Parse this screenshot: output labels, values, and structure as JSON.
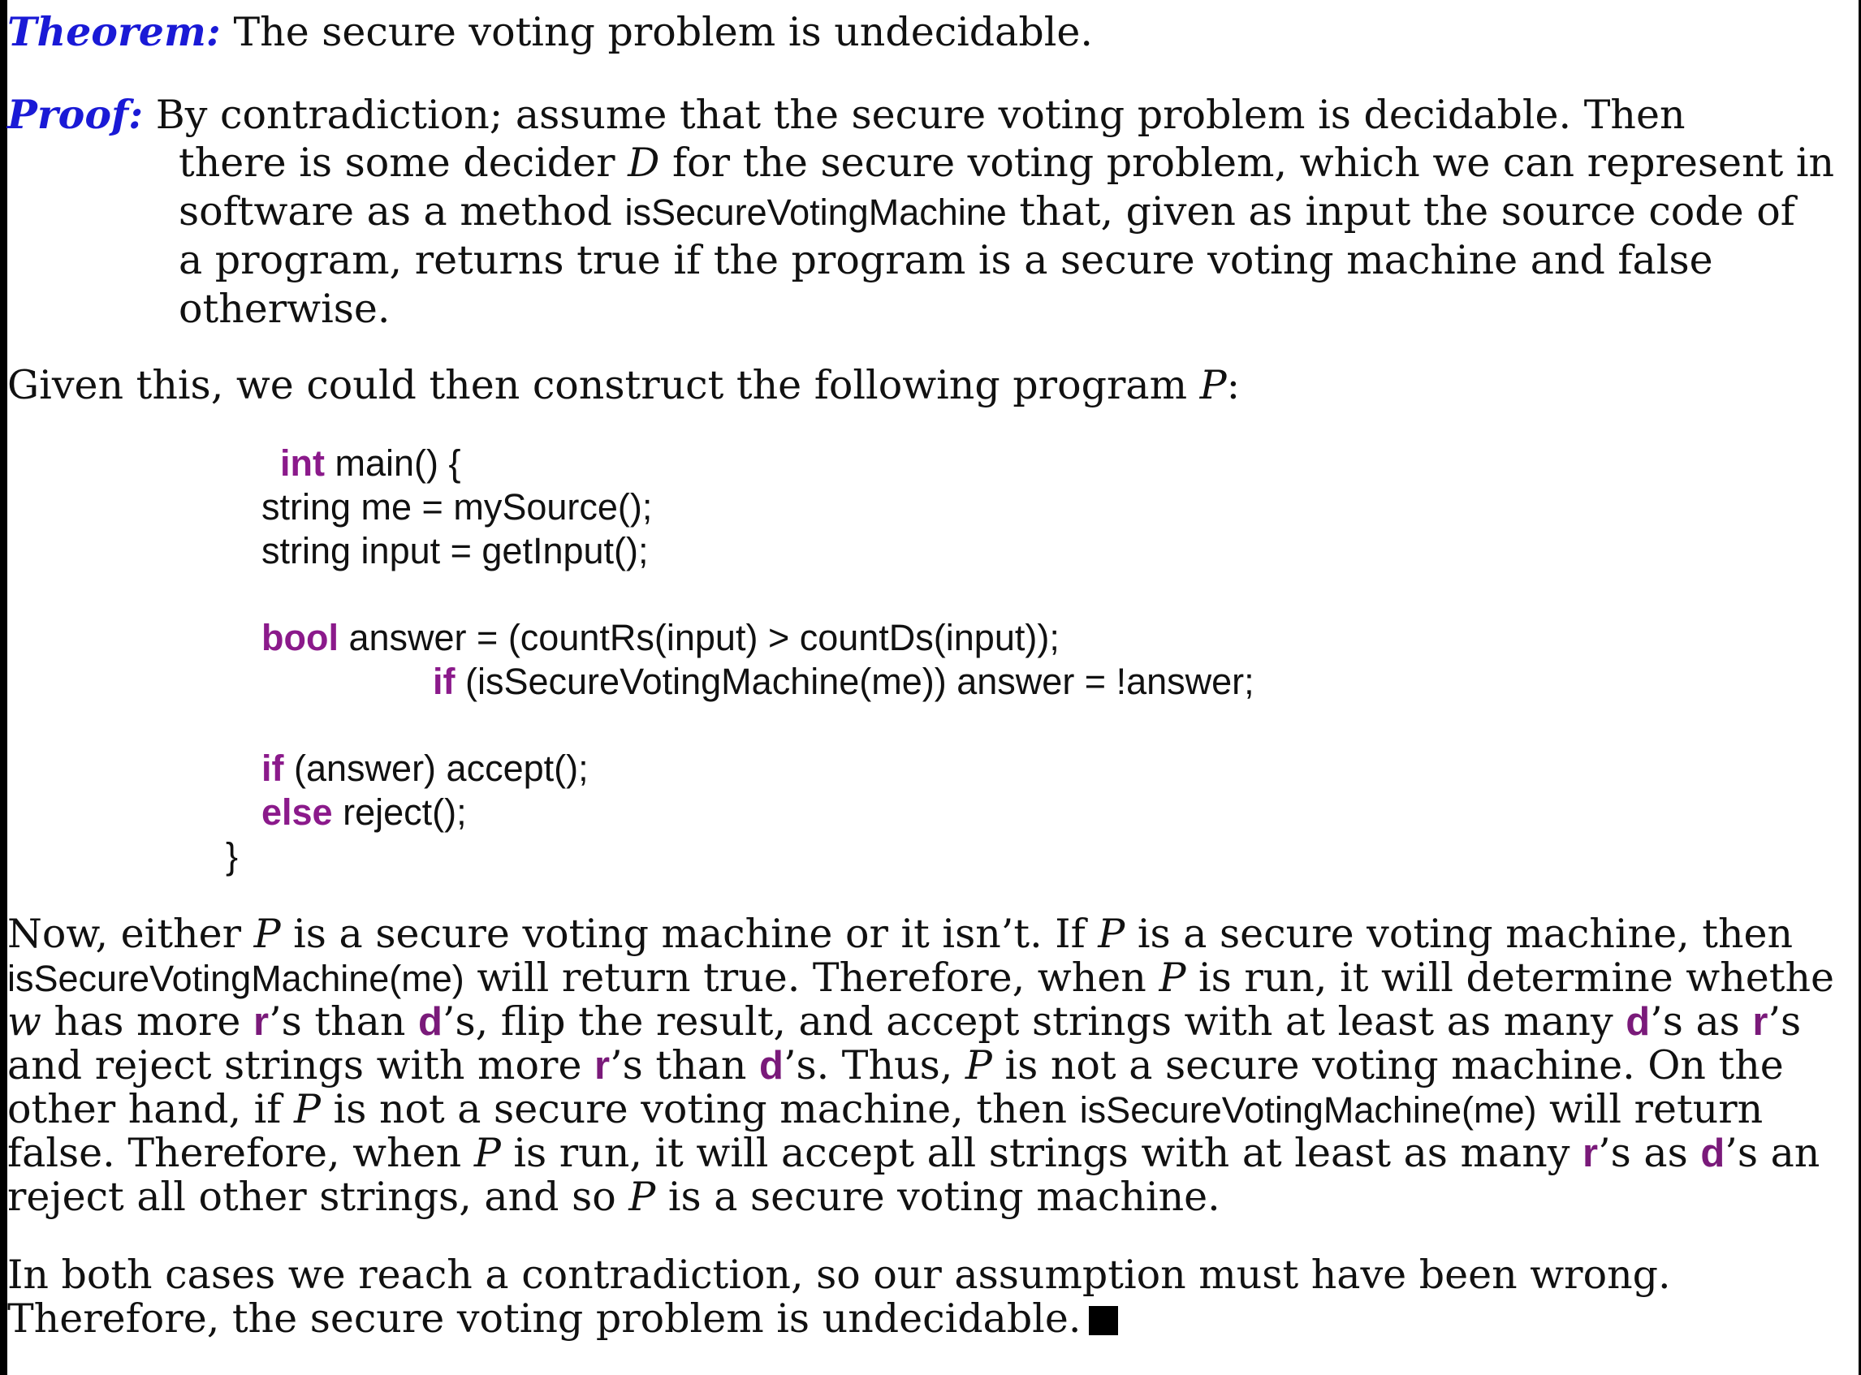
{
  "theorem": {
    "label": "Theorem:",
    "text": " The secure voting problem is undecidable."
  },
  "proof": {
    "label": "Proof:",
    "l1": " By contradiction; assume that the secure voting problem is decidable. Then",
    "l2a": "there is some decider ",
    "l2var": "D",
    "l2b": " for the secure voting problem, which we can represent in",
    "l3a": "software as a method ",
    "l3ident": "isSecureVotingMachine",
    "l3b": " that, given as input the source code of",
    "l4": "a program, returns true if the program is a secure voting machine and false",
    "l5": "otherwise."
  },
  "given": {
    "text": "Given this, we could then construct the following program ",
    "var": "P",
    "end": ":"
  },
  "code": {
    "line1_kw": "int",
    "line1_rest": " main() {",
    "line2": "string me = mySource();",
    "line3": "string input = getInput();",
    "line4_kw": "bool",
    "line4_rest": " answer = (countRs(input) > countDs(input));",
    "line5_kw": "if",
    "line5_rest": " (isSecureVotingMachine(me)) answer = !answer;",
    "line6_kw": "if",
    "line6_rest": " (answer) accept();",
    "line7_kw": "else",
    "line7_rest": " reject();",
    "line8": "}"
  },
  "argument": {
    "p1a": "Now, either ",
    "P": "P",
    "p1b": " is a secure voting machine or it isn’t. If ",
    "p1c": " is a secure voting machine, then",
    "p2ident": "isSecureVotingMachine(me)",
    "p2a": " will return true. Therefore, when ",
    "p2b": " is run, it will determine whethe",
    "w": "w",
    "p3a": " has more ",
    "r": "r",
    "d": "d",
    "s_than": "’s than ",
    "p3b": "’s, flip the result, and accept strings with at least as many ",
    "s_as": "’s as ",
    "s_end": "’s",
    "p4a": "and reject strings with more ",
    "p4b": "’s. Thus, ",
    "p4c": " is not a secure voting machine. On the",
    "p5a": "other hand, if ",
    "p5b": " is not a secure voting machine, then ",
    "p5c": " will return",
    "p6a": "false. Therefore, when ",
    "p6b": " is run, it will accept all strings with at least as many ",
    "p6c": "’s an",
    "p7a": "reject all other strings, and so ",
    "p7b": " is a secure voting machine."
  },
  "conclusion": {
    "l1": "In both cases we reach a contradiction, so our assumption must have been wrong.",
    "l2": "Therefore, the secure voting problem is undecidable."
  },
  "colors": {
    "heading": "#1a1ad6",
    "keyword": "#8b1a8b",
    "letter": "#7a1a7a"
  }
}
